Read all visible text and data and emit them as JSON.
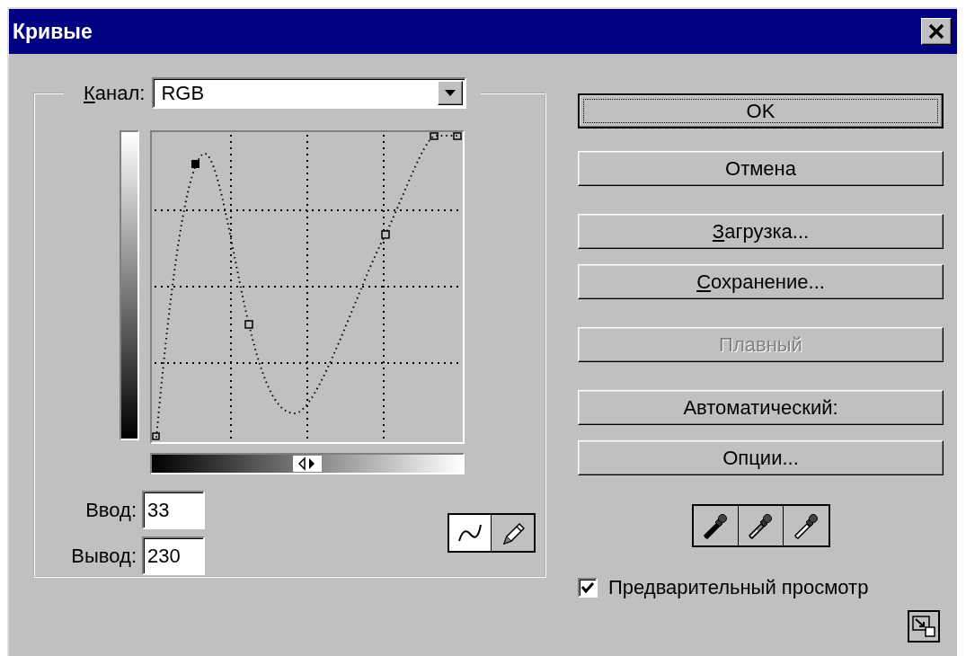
{
  "window": {
    "title": "Кривые"
  },
  "channel": {
    "label": "Канал:",
    "underline_first": true,
    "value": "RGB"
  },
  "input": {
    "label": "Ввод:",
    "value": "33"
  },
  "output": {
    "label": "Вывод:",
    "value": "230"
  },
  "curve_tools": [
    {
      "kind": "curve",
      "selected": true
    },
    {
      "kind": "pencil",
      "selected": false
    }
  ],
  "buttons": [
    {
      "label": "OK",
      "default": true,
      "disabled": false,
      "underline_first": false
    },
    {
      "label": "Отмена",
      "default": false,
      "disabled": false,
      "underline_first": false
    },
    {
      "label": "Загрузка...",
      "default": false,
      "disabled": false,
      "underline_first": true
    },
    {
      "label": "Сохранение...",
      "default": false,
      "disabled": false,
      "underline_first": true
    },
    {
      "label": "Плавный",
      "default": false,
      "disabled": true,
      "underline_first": false
    },
    {
      "label": "Автоматический:",
      "default": false,
      "disabled": false,
      "underline_first": false
    },
    {
      "label": "Опции...",
      "default": false,
      "disabled": false,
      "underline_first": false
    }
  ],
  "eyedroppers": [
    {
      "kind": "shadow"
    },
    {
      "kind": "midtone"
    },
    {
      "kind": "highlight"
    }
  ],
  "preview": {
    "label": "Предварительный просмотр",
    "checked": true
  }
}
